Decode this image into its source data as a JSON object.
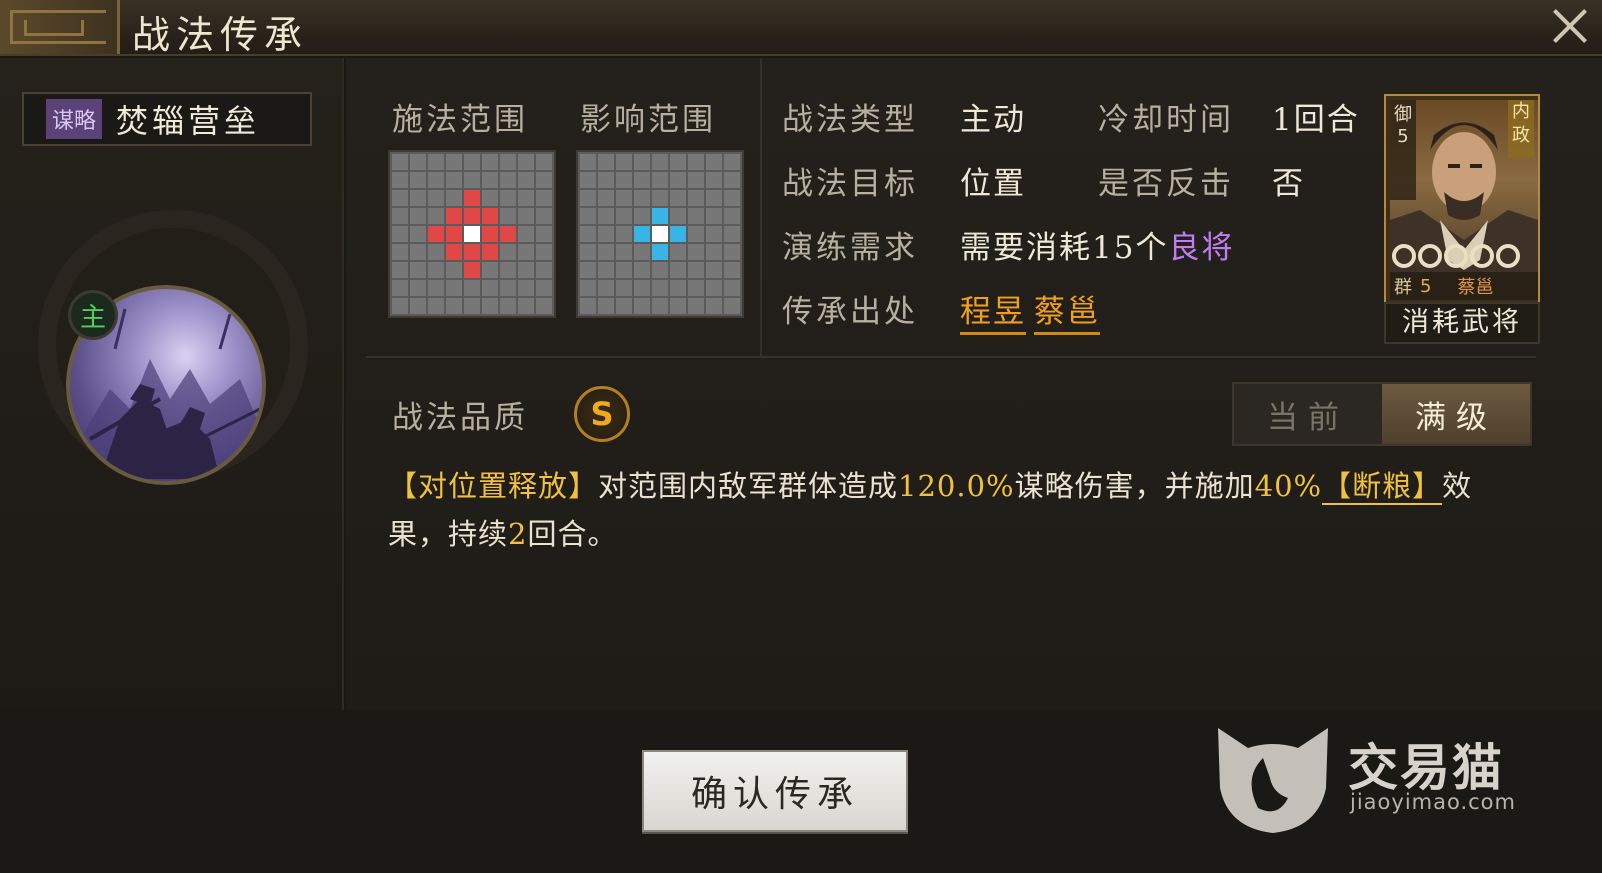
{
  "window": {
    "title": "战法传承"
  },
  "skill": {
    "type_tag": "谋略",
    "name": "焚辎营垒",
    "main_badge": "主"
  },
  "ranges": {
    "cast_label": "施法范围",
    "effect_label": "影响范围"
  },
  "info": {
    "type_label": "战法类型",
    "type_value": "主动",
    "cooldown_label": "冷却时间",
    "cooldown_value": "1回合",
    "target_label": "战法目标",
    "target_value": "位置",
    "counter_label": "是否反击",
    "counter_value": "否",
    "drill_label": "演练需求",
    "drill_value_prefix": "需要消耗15个",
    "drill_value_highlight": "良将",
    "origin_label": "传承出处",
    "origin_heroes": [
      "程昱",
      "蔡邕"
    ]
  },
  "hero_card": {
    "left_tag": "御5",
    "right_tag": "内政",
    "faction": "群",
    "level": "5",
    "name": "蔡邕",
    "stars": 5,
    "consume_label": "消耗武将"
  },
  "quality": {
    "label": "战法品质",
    "grade": "S"
  },
  "level_toggle": {
    "current": "当前",
    "max": "满级",
    "active": "max"
  },
  "description": {
    "p1": "【对位置释放】",
    "p2": "对范围内敌军群体造成",
    "p3": "120.0%",
    "p4": "谋略伤害，并施加",
    "p5": "40%",
    "p6": "【断粮】",
    "p7": "效果，持续",
    "p8": "2",
    "p9": "回合。"
  },
  "confirm_button": "确认传承",
  "watermark": {
    "text": "交易猫",
    "url": "jiaoyimao.com"
  },
  "colors": {
    "cast_cell": "#e04848",
    "effect_cell": "#38b4e6",
    "accent_gold": "#f0a020",
    "quality_gold": "#f1a91e"
  }
}
